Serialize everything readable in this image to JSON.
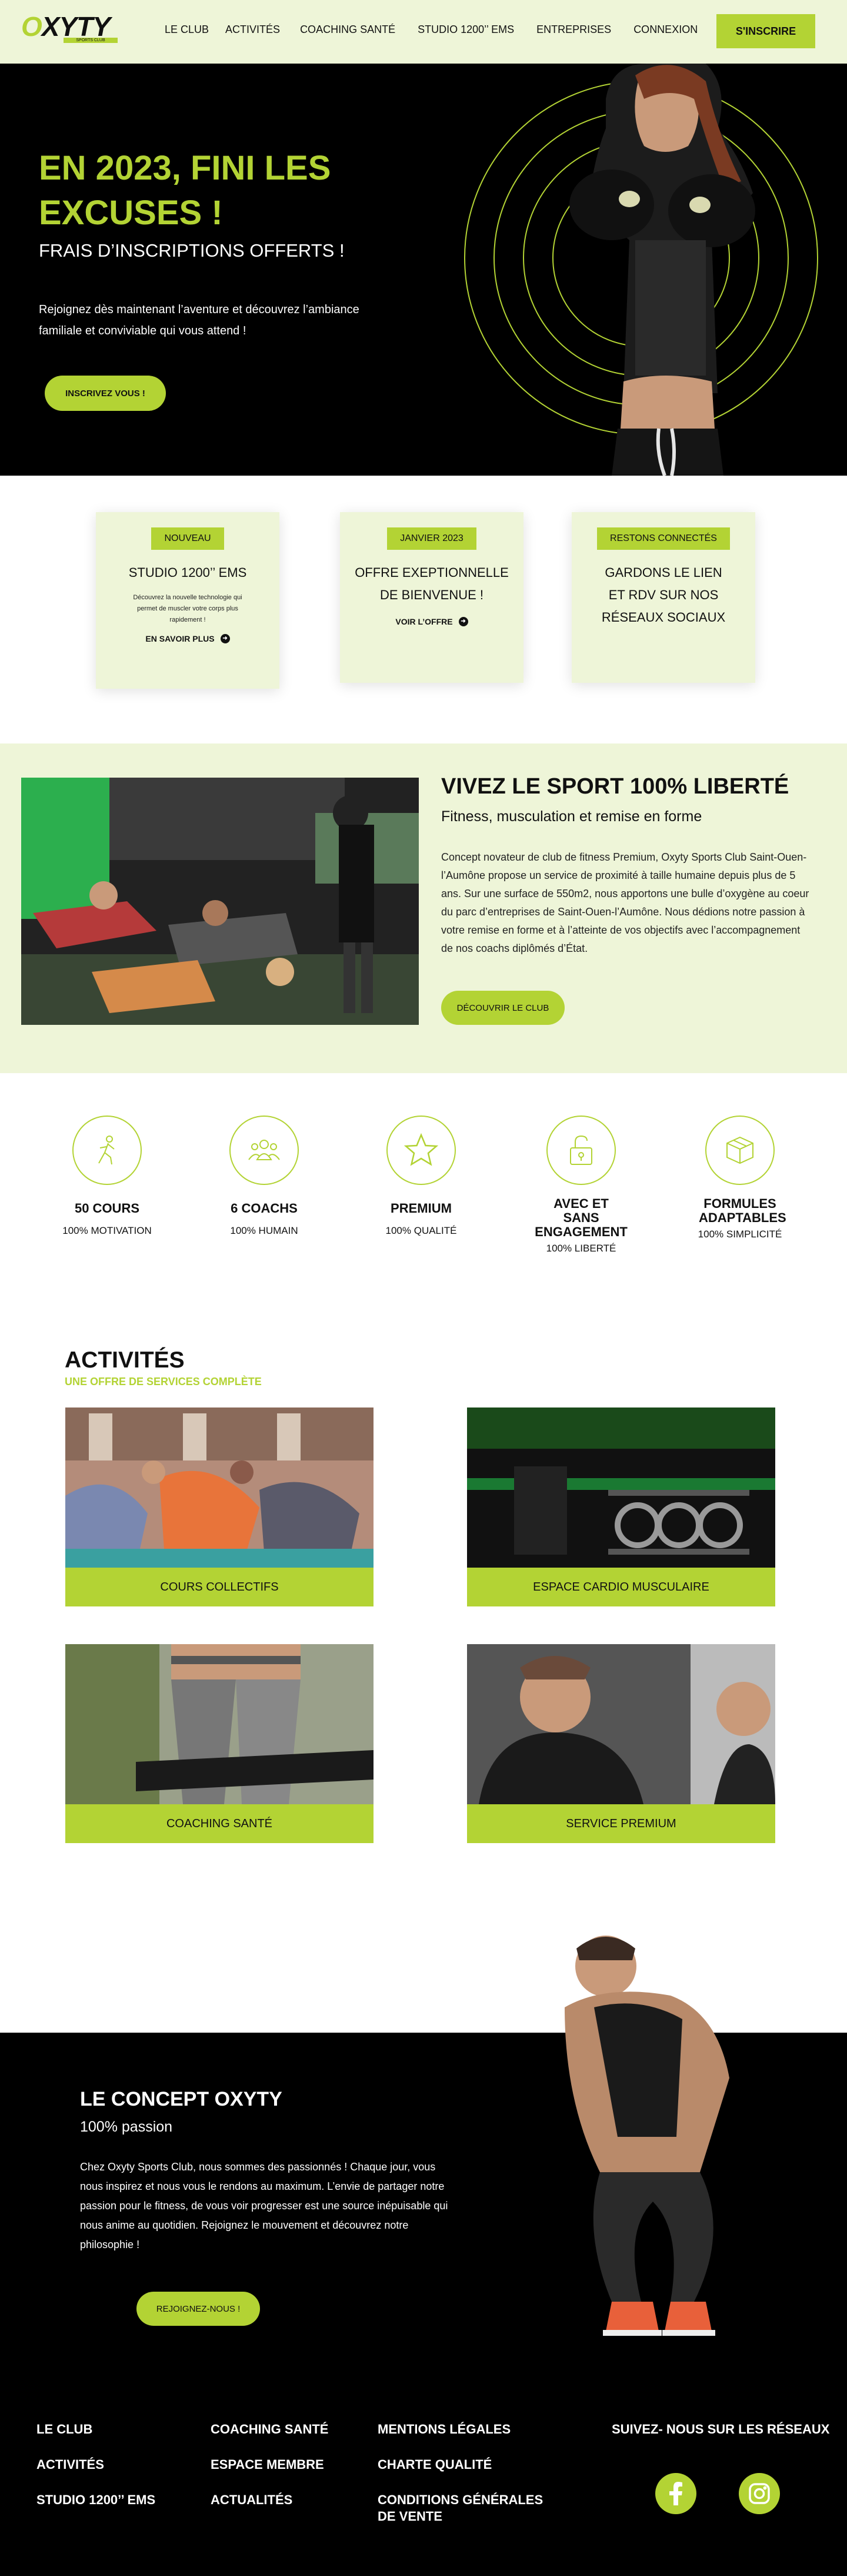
{
  "brand": {
    "name": "OXYTY",
    "tagline": "SPORTS CLUB",
    "accent": "#b3d334",
    "light_bg": "#eef5d8"
  },
  "nav": {
    "items": [
      "LE CLUB",
      "ACTIVITÉS",
      "COACHING SANTÉ",
      "STUDIO 1200’’ EMS",
      "ENTREPRISES",
      "CONNEXION"
    ],
    "cta": "S'INSCRIRE"
  },
  "hero": {
    "title": "EN 2023, FINI LES EXCUSES !",
    "subtitle": "FRAIS D’INSCRIPTIONS OFFERTS !",
    "text": "Rejoignez dès maintenant l’aventure et découvrez l’ambiance familiale et conviviable qui vous attend !",
    "cta": "INSCRIVEZ VOUS !"
  },
  "cards": [
    {
      "badge": "NOUVEAU",
      "title": "STUDIO 1200’’ EMS",
      "desc": "Découvrez la nouvelle technologie qui permet de muscler votre corps plus rapidement !",
      "link": "EN SAVOIR PLUS"
    },
    {
      "badge": "JANVIER 2023",
      "title": "OFFRE EXEPTIONNELLE DE BIENVENUE !",
      "desc": "",
      "link": "VOIR L’OFFRE"
    },
    {
      "badge": "RESTONS CONNECTÉS",
      "title": "GARDONS LE LIEN ET RDV SUR NOS RÉSEAUX SOCIAUX",
      "desc": "",
      "link": ""
    }
  ],
  "about": {
    "title": "VIVEZ LE SPORT 100% LIBERTÉ",
    "subtitle": "Fitness, musculation et remise en forme",
    "text": "Concept novateur de club de fitness Premium, Oxyty Sports Club Saint-Ouen-l’Aumône propose un service de proximité à taille humaine depuis plus de 5 ans. Sur une surface de 550m2, nous apportons une bulle d’oxygène au coeur du parc d’entreprises de Saint-Ouen-l’Aumône. Nous dédions notre passion à votre remise en forme et à l’atteinte de vos objectifs avec l’accompagnement de nos coachs diplômés d’État.",
    "cta": "DÉCOUVRIR LE CLUB"
  },
  "features": [
    {
      "title": "50 COURS",
      "sub": "100% MOTIVATION",
      "icon": "runner-icon"
    },
    {
      "title": "6 COACHS",
      "sub": "100% HUMAIN",
      "icon": "group-icon"
    },
    {
      "title": "PREMIUM",
      "sub": "100% QUALITÉ",
      "icon": "star-icon"
    },
    {
      "title": "AVEC ET SANS ENGAGEMENT",
      "sub": "100% LIBERTÉ",
      "icon": "unlock-icon"
    },
    {
      "title": "FORMULES ADAPTABLES",
      "sub": "100% SIMPLICITÉ",
      "icon": "box-icon"
    }
  ],
  "activities": {
    "title": "ACTIVITÉS",
    "subtitle": "UNE OFFRE DE SERVICES COMPLÈTE",
    "tiles": [
      "COURS COLLECTIFS",
      "ESPACE CARDIO MUSCULAIRE",
      "COACHING SANTÉ",
      "SERVICE PREMIUM"
    ]
  },
  "concept": {
    "title": "LE CONCEPT OXYTY",
    "subtitle": "100% passion",
    "text": "Chez Oxyty Sports Club, nous sommes des passionnés ! Chaque jour, vous nous inspirez et nous vous le rendons au maximum. L’envie de partager notre passion pour le fitness, de vous voir progresser est une source inépuisable qui nous anime au quotidien. Rejoignez le mouvement et découvrez notre philosophie !",
    "cta": "REJOIGNEZ-NOUS !"
  },
  "footer": {
    "col1": [
      "LE CLUB",
      "ACTIVITÉS",
      "STUDIO 1200’’ EMS"
    ],
    "col2": [
      "COACHING SANTÉ",
      "ESPACE MEMBRE",
      "ACTUALITÉS"
    ],
    "col3": [
      "MENTIONS LÉGALES",
      "CHARTE QUALITÉ",
      "CONDITIONS GÉNÉRALES DE VENTE"
    ],
    "social_title": "SUIVEZ- NOUS SUR LES RÉSEAUX",
    "social": [
      "facebook-icon",
      "instagram-icon"
    ]
  }
}
